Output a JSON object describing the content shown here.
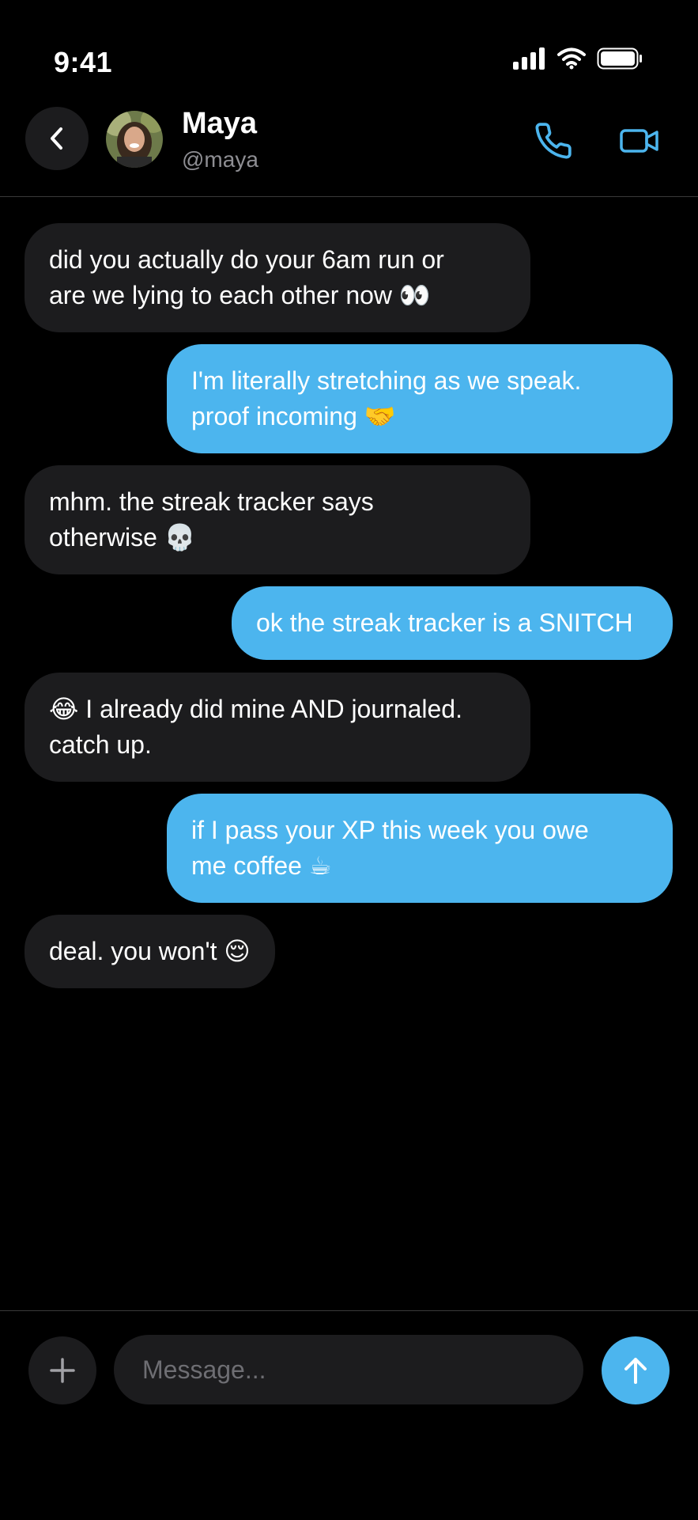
{
  "status_bar": {
    "time": "9:41"
  },
  "contact": {
    "name": "Maya",
    "handle": "@maya"
  },
  "messages": [
    {
      "from": "them",
      "line1": "did you actually do your 6am run or",
      "line2": "are we lying to each other now 👀"
    },
    {
      "from": "me",
      "line1": "I'm literally stretching as we speak.",
      "line2": "proof incoming 🤝"
    },
    {
      "from": "them",
      "line1": "mhm. the streak tracker says",
      "line2": "otherwise 💀"
    },
    {
      "from": "me",
      "line1": "ok the streak tracker is a SNITCH"
    },
    {
      "from": "them",
      "line1": "😂  I already did mine AND journaled.",
      "line2": "catch up."
    },
    {
      "from": "me",
      "line1": "if I pass your XP this week you owe",
      "line2": "me coffee ☕"
    },
    {
      "from": "them",
      "line1": "deal. you won't 😌"
    }
  ],
  "composer": {
    "placeholder": "Message..."
  },
  "colors": {
    "accent": "#4cb5ee",
    "bubble_incoming": "#1c1c1e",
    "background": "#000000"
  },
  "icons": {
    "back": "chevron-left-icon",
    "call": "phone-icon",
    "video": "video-camera-icon",
    "add": "plus-icon",
    "send": "arrow-up-icon"
  }
}
